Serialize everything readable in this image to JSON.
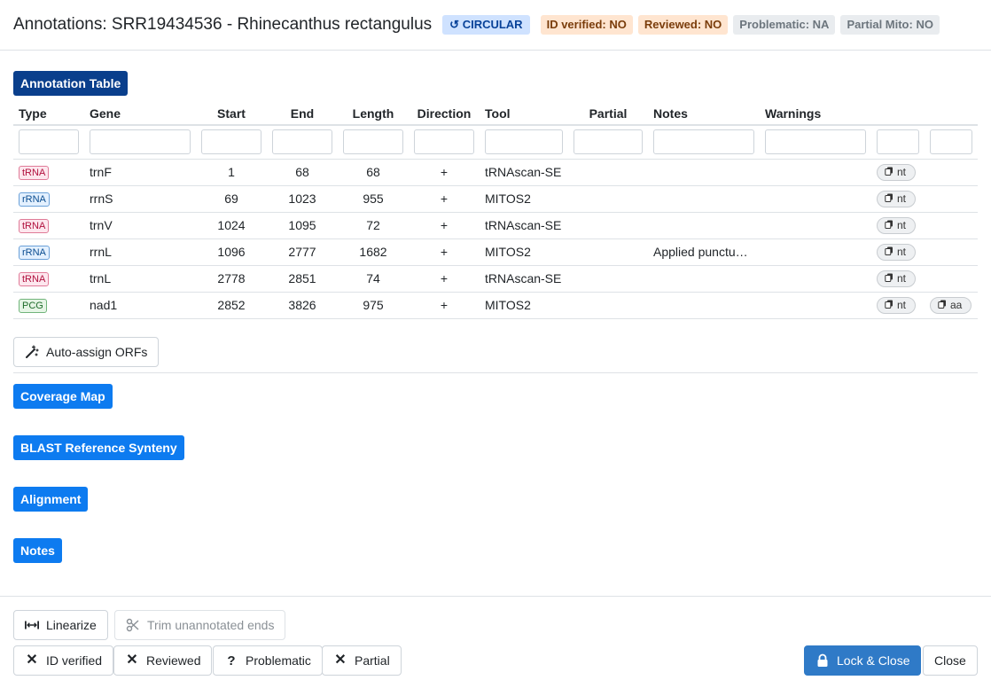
{
  "header": {
    "title": "Annotations: SRR19434536 - Rhinecanthus rectangulus",
    "circular": "CIRCULAR",
    "id_verified": "ID verified: NO",
    "reviewed": "Reviewed: NO",
    "problematic": "Problematic: NA",
    "partial_mito": "Partial Mito: NO"
  },
  "sections": {
    "annotation_table": "Annotation Table",
    "coverage_map": "Coverage Map",
    "blast_synteny": "BLAST Reference Synteny",
    "alignment": "Alignment",
    "notes": "Notes"
  },
  "table": {
    "columns": [
      "Type",
      "Gene",
      "Start",
      "End",
      "Length",
      "Direction",
      "Tool",
      "Partial",
      "Notes",
      "Warnings"
    ],
    "rows": [
      {
        "type": "tRNA",
        "gene": "trnF",
        "start": "1",
        "end": "68",
        "length": "68",
        "direction": "+",
        "tool": "tRNAscan-SE",
        "partial": "",
        "notes": "",
        "warnings": "",
        "copy_nt": "nt",
        "copy_aa": ""
      },
      {
        "type": "rRNA",
        "gene": "rrnS",
        "start": "69",
        "end": "1023",
        "length": "955",
        "direction": "+",
        "tool": "MITOS2",
        "partial": "",
        "notes": "",
        "warnings": "",
        "copy_nt": "nt",
        "copy_aa": ""
      },
      {
        "type": "tRNA",
        "gene": "trnV",
        "start": "1024",
        "end": "1095",
        "length": "72",
        "direction": "+",
        "tool": "tRNAscan-SE",
        "partial": "",
        "notes": "",
        "warnings": "",
        "copy_nt": "nt",
        "copy_aa": ""
      },
      {
        "type": "rRNA",
        "gene": "rrnL",
        "start": "1096",
        "end": "2777",
        "length": "1682",
        "direction": "+",
        "tool": "MITOS2",
        "partial": "",
        "notes": "Applied punctu…",
        "warnings": "",
        "copy_nt": "nt",
        "copy_aa": ""
      },
      {
        "type": "tRNA",
        "gene": "trnL",
        "start": "2778",
        "end": "2851",
        "length": "74",
        "direction": "+",
        "tool": "tRNAscan-SE",
        "partial": "",
        "notes": "",
        "warnings": "",
        "copy_nt": "nt",
        "copy_aa": ""
      },
      {
        "type": "PCG",
        "gene": "nad1",
        "start": "2852",
        "end": "3826",
        "length": "975",
        "direction": "+",
        "tool": "MITOS2",
        "partial": "",
        "notes": "",
        "warnings": "",
        "copy_nt": "nt",
        "copy_aa": "aa"
      }
    ]
  },
  "buttons": {
    "auto_assign": "Auto-assign ORFs",
    "linearize": "Linearize",
    "trim": "Trim unannotated ends",
    "id_verified": "ID verified",
    "reviewed": "Reviewed",
    "problematic": "Problematic",
    "partial": "Partial",
    "lock_close": "Lock & Close",
    "close": "Close"
  },
  "colors": {
    "primary": "#0d7bf0",
    "section_active": "#0a3f8c",
    "lock_button": "#2f7ac7"
  }
}
